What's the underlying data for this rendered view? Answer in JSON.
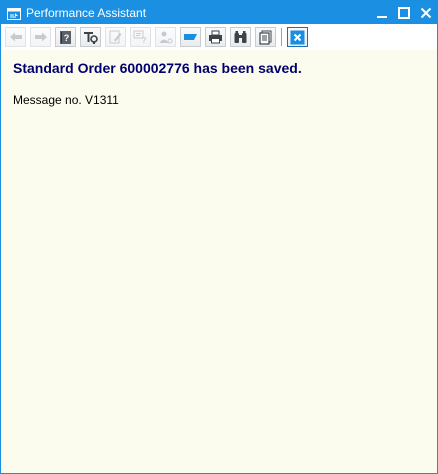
{
  "window": {
    "title": "Performance Assistant",
    "title_color": "#1b90e2",
    "background_color": "#fcfcee"
  },
  "toolbar": {
    "buttons": [
      {
        "icon": "back-arrow-icon",
        "enabled": false
      },
      {
        "icon": "forward-arrow-icon",
        "enabled": false
      },
      {
        "icon": "help-book-icon",
        "enabled": true
      },
      {
        "icon": "technical-info-icon",
        "enabled": true
      },
      {
        "icon": "edit-document-icon",
        "enabled": false
      },
      {
        "icon": "field-help-icon",
        "enabled": false
      },
      {
        "icon": "user-settings-icon",
        "enabled": false
      },
      {
        "icon": "bookmark-icon",
        "enabled": true
      },
      {
        "icon": "print-icon",
        "enabled": true
      },
      {
        "icon": "find-icon",
        "enabled": true
      },
      {
        "icon": "document-list-icon",
        "enabled": true
      },
      {
        "icon": "close-icon",
        "enabled": true
      }
    ]
  },
  "message": {
    "title": "Standard Order 600002776 has been saved.",
    "title_color": "#00006e",
    "number_text": "Message no. V1311"
  }
}
